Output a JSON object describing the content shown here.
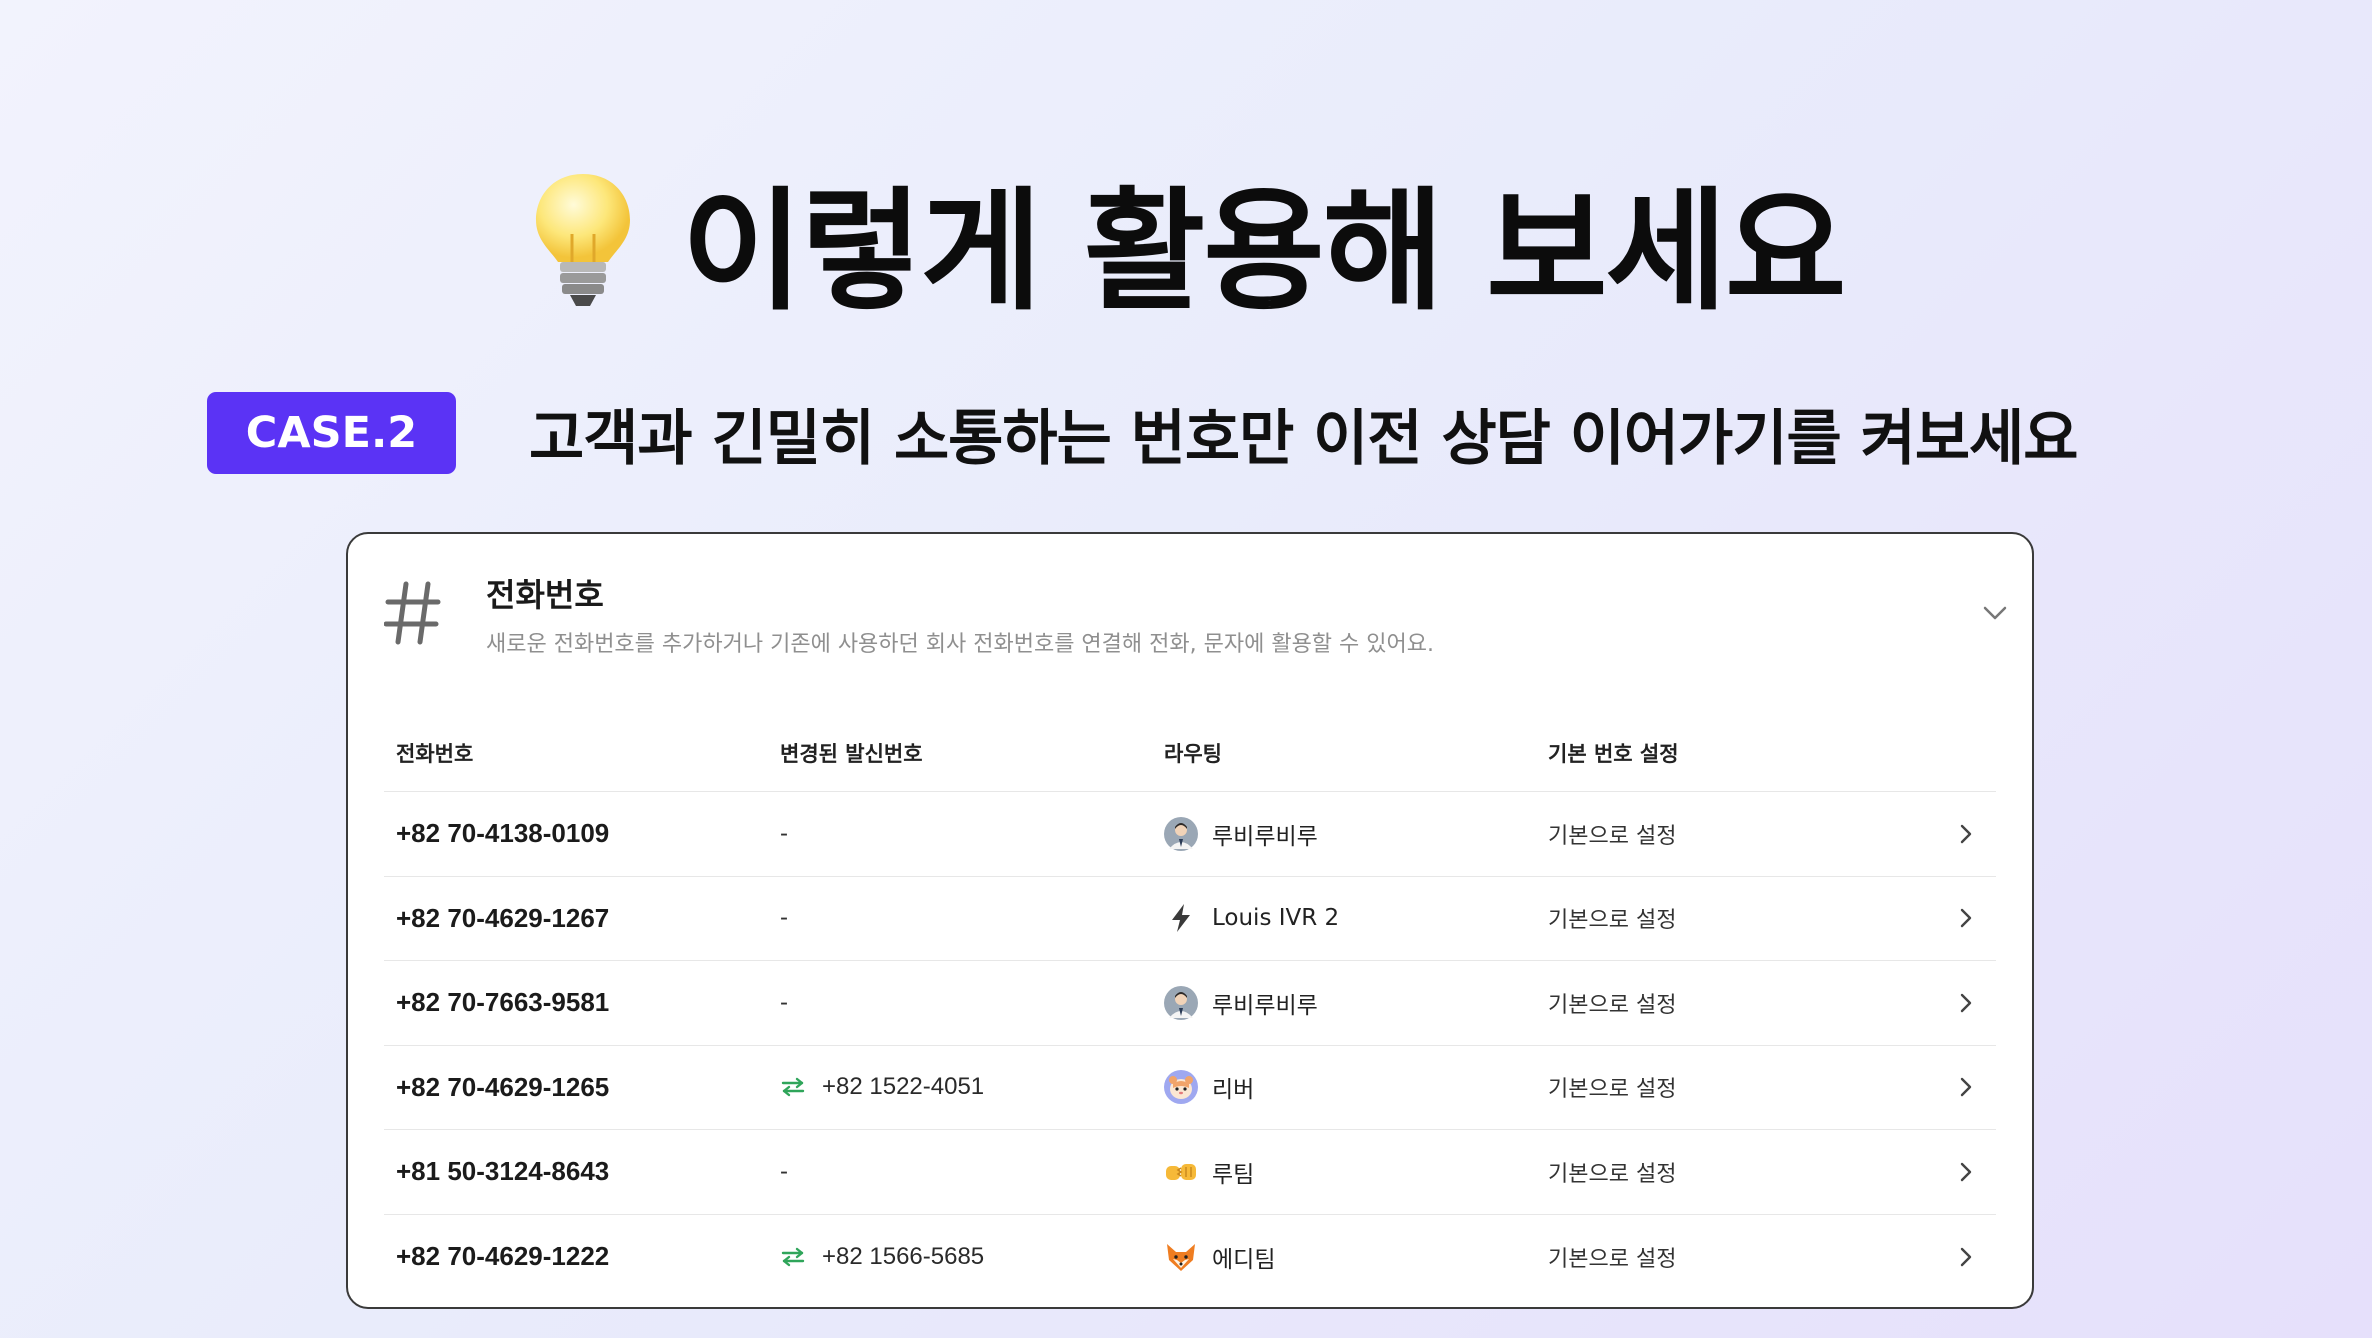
{
  "hero": {
    "title": "이렇게 활용해 보세요"
  },
  "case": {
    "badge": "CASE.2",
    "text": "고객과 긴밀히 소통하는 번호만 이전 상담 이어가기를 켜보세요"
  },
  "card": {
    "title": "전화번호",
    "description": "새로운 전화번호를 추가하거나 기존에 사용하던 회사 전화번호를 연결해 전화, 문자에 활용할 수 있어요.",
    "columns": [
      "전화번호",
      "변경된 발신번호",
      "라우팅",
      "기본 번호 설정"
    ],
    "rows": [
      {
        "phone": "+82 70-4138-0109",
        "alt": "-",
        "alt_swap": false,
        "route_icon": "person-avatar",
        "route": "루비루비루",
        "default": "기본으로 설정"
      },
      {
        "phone": "+82 70-4629-1267",
        "alt": "-",
        "alt_swap": false,
        "route_icon": "bolt-icon",
        "route": "Louis IVR 2",
        "default": "기본으로 설정"
      },
      {
        "phone": "+82 70-7663-9581",
        "alt": "-",
        "alt_swap": false,
        "route_icon": "person-avatar",
        "route": "루비루비루",
        "default": "기본으로 설정"
      },
      {
        "phone": "+82 70-4629-1265",
        "alt": "+82 1522-4051",
        "alt_swap": true,
        "route_icon": "hamster-avatar",
        "route": "리버",
        "default": "기본으로 설정"
      },
      {
        "phone": "+81 50-3124-8643",
        "alt": "-",
        "alt_swap": false,
        "route_icon": "fist-bump-icon",
        "route": "루팀",
        "default": "기본으로 설정"
      },
      {
        "phone": "+82 70-4629-1222",
        "alt": "+82 1566-5685",
        "alt_swap": true,
        "route_icon": "fox-icon",
        "route": "에디팀",
        "default": "기본으로 설정"
      }
    ]
  },
  "colors": {
    "accent": "#5b33f5",
    "swap": "#2fa55a"
  }
}
